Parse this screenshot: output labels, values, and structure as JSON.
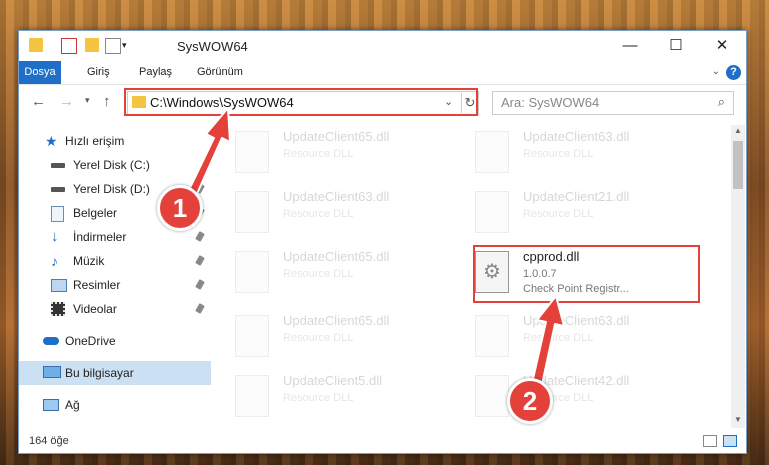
{
  "window": {
    "title": "SysWOW64"
  },
  "ribbon": {
    "tabs": [
      "Dosya",
      "Giriş",
      "Paylaş",
      "Görünüm"
    ]
  },
  "address": {
    "path": "C:\\Windows\\SysWOW64"
  },
  "search": {
    "placeholder": "Ara: SysWOW64"
  },
  "sidebar": {
    "items": [
      {
        "label": "Hızlı erişim",
        "icon": "star-icon"
      },
      {
        "label": "Yerel Disk (C:)",
        "icon": "drive-icon"
      },
      {
        "label": "Yerel Disk (D:)",
        "icon": "drive-icon"
      },
      {
        "label": "Belgeler",
        "icon": "document-icon"
      },
      {
        "label": "İndirmeler",
        "icon": "download-icon"
      },
      {
        "label": "Müzik",
        "icon": "music-icon"
      },
      {
        "label": "Resimler",
        "icon": "pictures-icon"
      },
      {
        "label": "Videolar",
        "icon": "video-icon"
      },
      {
        "label": "OneDrive",
        "icon": "cloud-icon"
      },
      {
        "label": "Bu bilgisayar",
        "icon": "computer-icon"
      },
      {
        "label": "Ağ",
        "icon": "network-icon"
      }
    ]
  },
  "files": [
    {
      "name": "UpdateClient65.dll",
      "meta": "Resource DLL"
    },
    {
      "name": "UpdateClient63.dll",
      "meta": "Resource DLL"
    },
    {
      "name": "UpdateClient63.dll",
      "meta": "Resource DLL"
    },
    {
      "name": "UpdateClient21.dll",
      "meta": "Resource DLL"
    },
    {
      "name": "UpdateClient65.dll",
      "meta": "Resource DLL"
    },
    {
      "name": "cpprod.dll",
      "version": "1.0.0.7",
      "meta": "Check Point Registr..."
    },
    {
      "name": "UpdateClient65.dll",
      "meta": "Resource DLL"
    },
    {
      "name": "UpdateClient63.dll",
      "meta": "Resource DLL"
    },
    {
      "name": "UpdateClient5.dll",
      "meta": "Resource DLL"
    },
    {
      "name": "UpdateClient42.dll",
      "meta": "Resource DLL"
    }
  ],
  "status": {
    "count": "164 öğe"
  },
  "annotations": {
    "step1": "1",
    "step2": "2"
  },
  "colors": {
    "accent": "#1f6fc9",
    "highlight": "#e3413a"
  }
}
